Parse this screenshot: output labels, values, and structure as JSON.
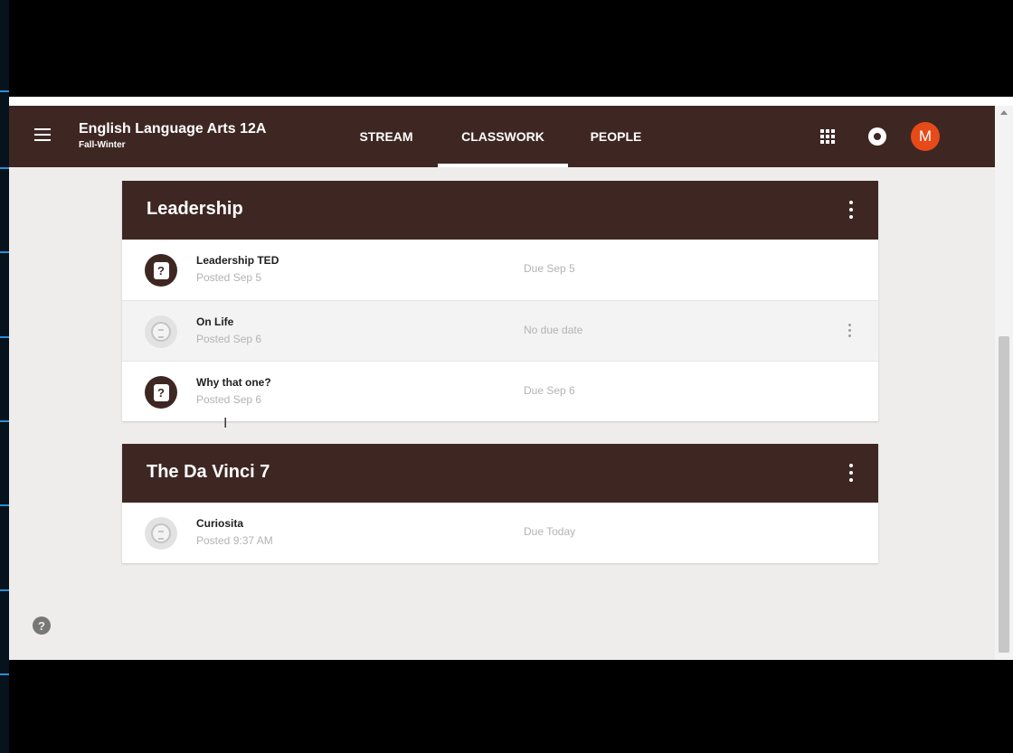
{
  "header": {
    "class_title": "English Language Arts 12A",
    "class_subtitle": "Fall-Winter",
    "menu_icon": "menu-icon",
    "apps_icon": "apps-grid-icon",
    "notifications_icon": "notifications-icon",
    "avatar_initial": "M",
    "avatar_color": "#e64a19",
    "bar_color": "#3e2723"
  },
  "tabs": [
    {
      "label": "STREAM",
      "active": false
    },
    {
      "label": "CLASSWORK",
      "active": true
    },
    {
      "label": "PEOPLE",
      "active": false
    }
  ],
  "topics": [
    {
      "title": "Leadership",
      "items": [
        {
          "title": "Leadership TED",
          "posted": "Posted Sep 5",
          "due": "Due Sep 5",
          "icon": "question-icon"
        },
        {
          "title": "On Life",
          "posted": "Posted Sep 6",
          "due": "No due date",
          "icon": "material-icon"
        },
        {
          "title": "Why that one?",
          "posted": "Posted Sep 6",
          "due": "Due Sep 6",
          "icon": "question-icon"
        }
      ]
    },
    {
      "title": "The Da Vinci 7",
      "items": [
        {
          "title": "Curiosita",
          "posted": "Posted 9:37 AM",
          "due": "Due Today",
          "icon": "material-icon"
        }
      ]
    }
  ],
  "help_icon": "help-icon",
  "question_glyph": "?"
}
